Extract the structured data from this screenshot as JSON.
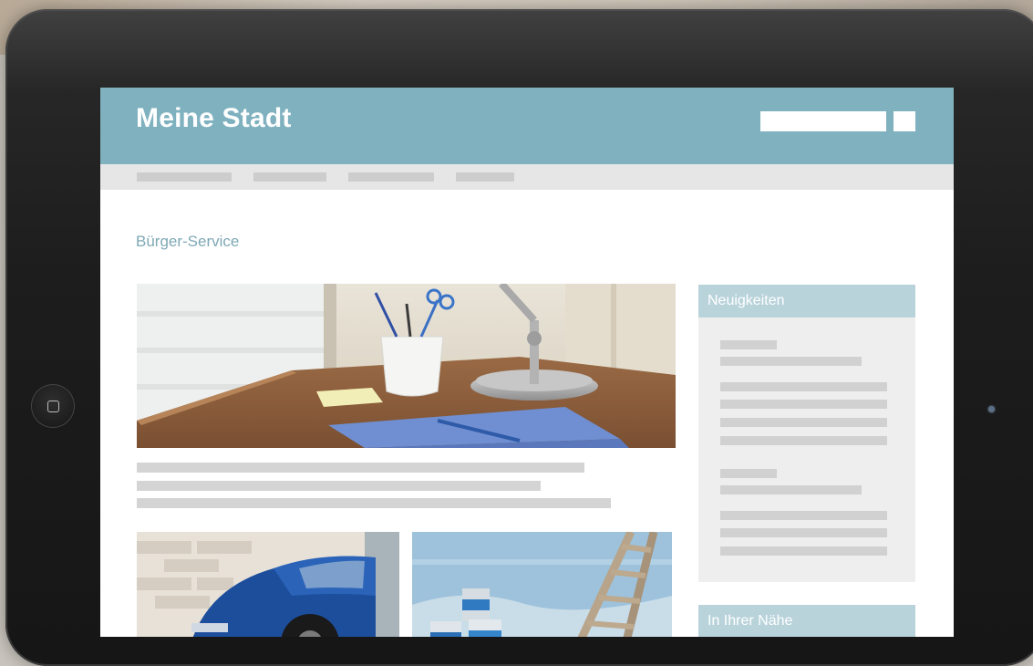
{
  "site": {
    "title": "Meine Stadt",
    "search": {
      "placeholder": ""
    }
  },
  "navigation": {
    "items": [
      "",
      "",
      "",
      ""
    ]
  },
  "breadcrumb": "Bürger-Service",
  "sidebar": {
    "news_heading": "Neuigkeiten",
    "nearby_heading": "In Ihrer Nähe"
  },
  "colors": {
    "header": "#7fb1bf",
    "nav": "#e6e6e6",
    "accent_text": "#7fa9b6",
    "sidebar_heading": "#b9d3db",
    "placeholder_bars": "#d4d4d4"
  },
  "icons": {
    "home_button": "home-square-icon"
  }
}
